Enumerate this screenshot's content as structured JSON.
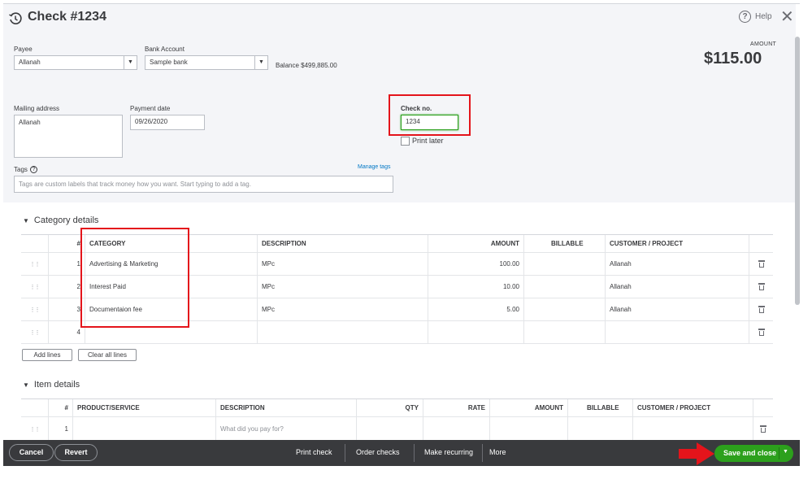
{
  "header": {
    "title": "Check #1234",
    "help_label": "Help",
    "help_glyph": "?",
    "close_glyph": "✕"
  },
  "form": {
    "payee_label": "Payee",
    "payee_value": "Allanah",
    "bank_label": "Bank Account",
    "bank_value": "Sample bank",
    "balance_label": "Balance",
    "balance_value": "$499,885.00",
    "amount_label": "AMOUNT",
    "amount_value": "$115.00",
    "mailing_label": "Mailing address",
    "mailing_value": "Allanah",
    "payment_date_label": "Payment date",
    "payment_date_value": "09/26/2020",
    "check_no_label": "Check no.",
    "check_no_value": "1234",
    "print_later_label": "Print later",
    "tags_label": "Tags",
    "manage_tags": "Manage tags",
    "tags_placeholder": "Tags are custom labels that track money how you want. Start typing to add a tag."
  },
  "category": {
    "section_title": "Category details",
    "columns": {
      "num": "#",
      "category": "CATEGORY",
      "description": "DESCRIPTION",
      "amount": "AMOUNT",
      "billable": "BILLABLE",
      "customer": "CUSTOMER / PROJECT"
    },
    "rows": [
      {
        "num": "1",
        "category": "Advertising & Marketing",
        "description": "MPc",
        "amount": "100.00",
        "customer": "Allanah"
      },
      {
        "num": "2",
        "category": "Interest Paid",
        "description": "MPc",
        "amount": "10.00",
        "customer": "Allanah"
      },
      {
        "num": "3",
        "category": "Documentaion fee",
        "description": "MPc",
        "amount": "5.00",
        "customer": "Allanah"
      },
      {
        "num": "4",
        "category": "",
        "description": "",
        "amount": "",
        "customer": ""
      }
    ],
    "add_lines": "Add lines",
    "clear_lines": "Clear all lines"
  },
  "items": {
    "section_title": "Item details",
    "columns": {
      "num": "#",
      "product": "PRODUCT/SERVICE",
      "description": "DESCRIPTION",
      "qty": "QTY",
      "rate": "RATE",
      "amount": "AMOUNT",
      "billable": "BILLABLE",
      "customer": "CUSTOMER / PROJECT"
    },
    "rows": [
      {
        "num": "1",
        "description_placeholder": "What did you pay for?"
      }
    ]
  },
  "footer": {
    "cancel": "Cancel",
    "revert": "Revert",
    "print_check": "Print check",
    "order_checks": "Order checks",
    "make_recurring": "Make recurring",
    "more": "More",
    "save_and_close": "Save and close"
  },
  "colors": {
    "accent_green": "#2ca01c",
    "annotation_red": "#e4141b",
    "footer_bg": "#393a3d",
    "link_blue": "#0077c5"
  },
  "icons": [
    "history-icon",
    "help-icon",
    "close-icon",
    "chevron-down-icon",
    "info-icon",
    "drag-handle-icon",
    "trash-icon",
    "red-arrow-icon"
  ]
}
